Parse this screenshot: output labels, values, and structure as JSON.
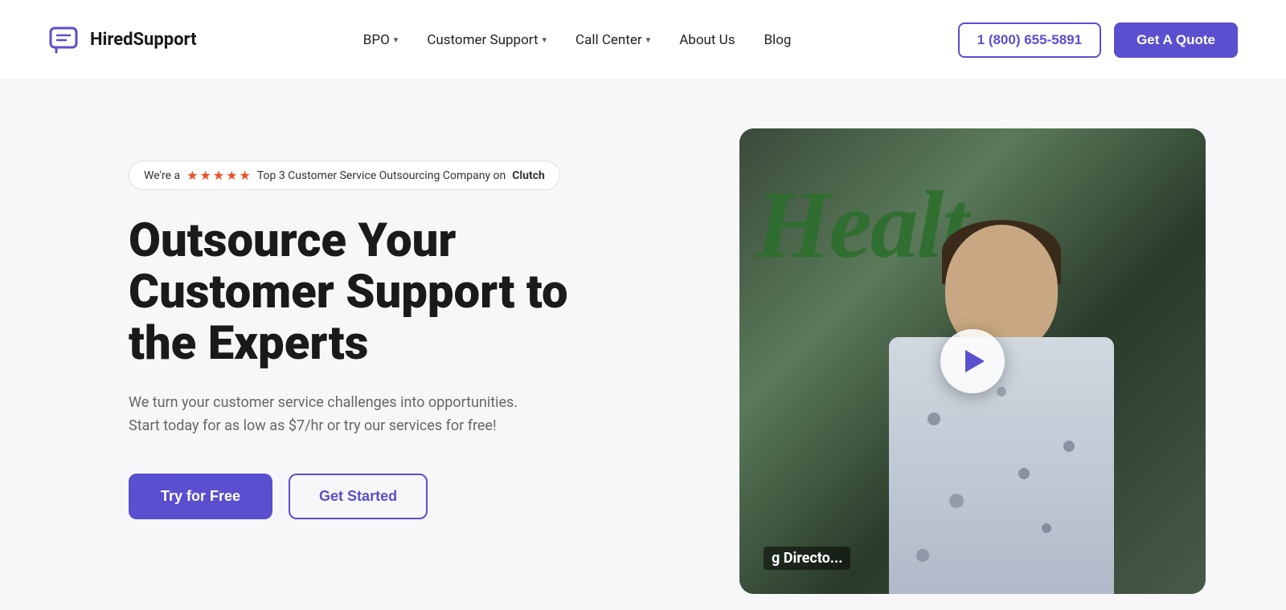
{
  "header": {
    "logo_text": "HiredSupport",
    "nav": {
      "bpo_label": "BPO",
      "customer_support_label": "Customer Support",
      "call_center_label": "Call Center",
      "about_us_label": "About Us",
      "blog_label": "Blog"
    },
    "phone": "1 (800) 655-5891",
    "quote_btn": "Get A Quote"
  },
  "hero": {
    "badge_prefix": "We're a",
    "badge_suffix": "Top 3 Customer Service Outsourcing Company on",
    "badge_bold": "Clutch",
    "title_line1": "Outsource Your",
    "title_line2": "Customer Support to",
    "title_line3": "the Experts",
    "subtitle": "We turn your customer service challenges into opportunities. Start today for as low as $7/hr or try our services for free!",
    "try_free_btn": "Try for Free",
    "get_started_btn": "Get Started",
    "video_bottom_text": "g Directo..."
  },
  "icons": {
    "chat_bubble": "💬",
    "chevron": "▾",
    "play": "▶"
  },
  "colors": {
    "accent": "#5a4fcf",
    "star_color": "#f04e23"
  }
}
